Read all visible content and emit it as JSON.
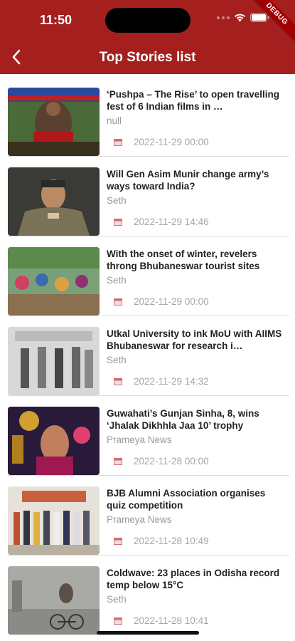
{
  "status_bar": {
    "time": "11:50"
  },
  "debug_banner": "DEBUG",
  "header": {
    "title": "Top Stories list",
    "back_icon": "chevron-left-icon"
  },
  "accent_color": "#a61f1f",
  "stories": [
    {
      "title": "‘Pushpa – The Rise’ to open travelling fest of 6 Indian films in …",
      "source": "null",
      "date": "2022-11-29 00:00"
    },
    {
      "title": "Will Gen Asim Munir change army’s ways toward India?",
      "source": "Seth",
      "date": "2022-11-29 14:46"
    },
    {
      "title": "With the onset of winter, revelers throng Bhubaneswar tourist sites",
      "source": "Seth",
      "date": "2022-11-29 00:00"
    },
    {
      "title": "Utkal University to ink MoU with AIIMS Bhubaneswar for research i…",
      "source": "Seth",
      "date": "2022-11-29 14:32"
    },
    {
      "title": "Guwahati’s Gunjan Sinha, 8, wins ‘Jhalak Dikhhla Jaa 10’ trophy",
      "source": "Prameya News",
      "date": "2022-11-28 00:00"
    },
    {
      "title": "BJB Alumni Association organises quiz competition",
      "source": "Prameya News",
      "date": "2022-11-28 10:49"
    },
    {
      "title": "Coldwave: 23 places in Odisha record temp below 15°C",
      "source": "Seth",
      "date": "2022-11-28 10:41"
    }
  ]
}
